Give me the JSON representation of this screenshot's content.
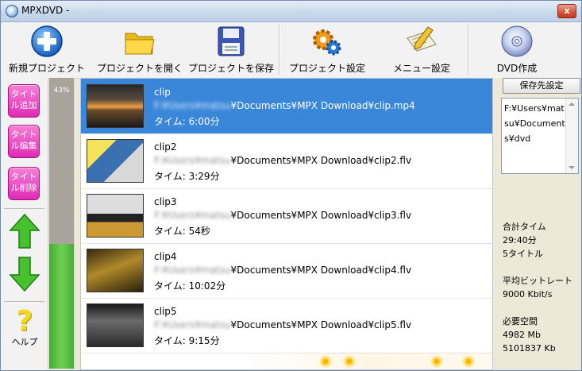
{
  "window": {
    "title": "MPXDVD -",
    "close_label": "x"
  },
  "toolbar": {
    "new_project": "新規プロジェクト",
    "open_project": "プロジェクトを開く",
    "save_project": "プロジェクトを保存",
    "project_settings": "プロジェクト設定",
    "menu_settings": "メニュー設定",
    "create_dvd": "DVD作成"
  },
  "sidebar": {
    "add_title": "タイトル追加",
    "edit_title": "タイトル編集",
    "delete_title": "タイトル削除",
    "help": "ヘルプ"
  },
  "progress": {
    "percent_label": "43%",
    "value": 0.43
  },
  "clips": [
    {
      "name": "clip",
      "path_prefix": "F:¥Users¥matsu",
      "path_suffix": "¥Documents¥MPX Download¥clip.mp4",
      "duration": "タイム: 6:00分",
      "selected": true
    },
    {
      "name": "clip2",
      "path_prefix": "F:¥Users¥matsu",
      "path_suffix": "¥Documents¥MPX Download¥clip2.flv",
      "duration": "タイム: 3:29分",
      "selected": false
    },
    {
      "name": "clip3",
      "path_prefix": "F:¥Users¥matsu",
      "path_suffix": "¥Documents¥MPX Download¥clip3.flv",
      "duration": "タイム: 54秒",
      "selected": false
    },
    {
      "name": "clip4",
      "path_prefix": "F:¥Users¥matsu",
      "path_suffix": "¥Documents¥MPX Download¥clip4.flv",
      "duration": "タイム: 10:02分",
      "selected": false
    },
    {
      "name": "clip5",
      "path_prefix": "F:¥Users¥matsu",
      "path_suffix": "¥Documents¥MPX Download¥clip5.flv",
      "duration": "タイム: 9:15分",
      "selected": false
    }
  ],
  "right_panel": {
    "save_dest_button": "保存先設定",
    "save_path": "F:¥Users¥matsu¥Documents¥dvd",
    "total_time_label": "合計タイム",
    "total_time_value": "29:40分",
    "title_count": "5タイトル",
    "avg_bitrate_label": "平均ビットレート",
    "avg_bitrate_value": "9000 Kbit/s",
    "required_space_label": "必要空間",
    "required_space_mb": "4982 Mb",
    "required_space_kb": "5101837 Kb"
  },
  "colors": {
    "selection": "#3a87d9",
    "pink_button": "#e02ab5",
    "progress_fill": "#5cc443",
    "arrow_green": "#3fb22a"
  }
}
